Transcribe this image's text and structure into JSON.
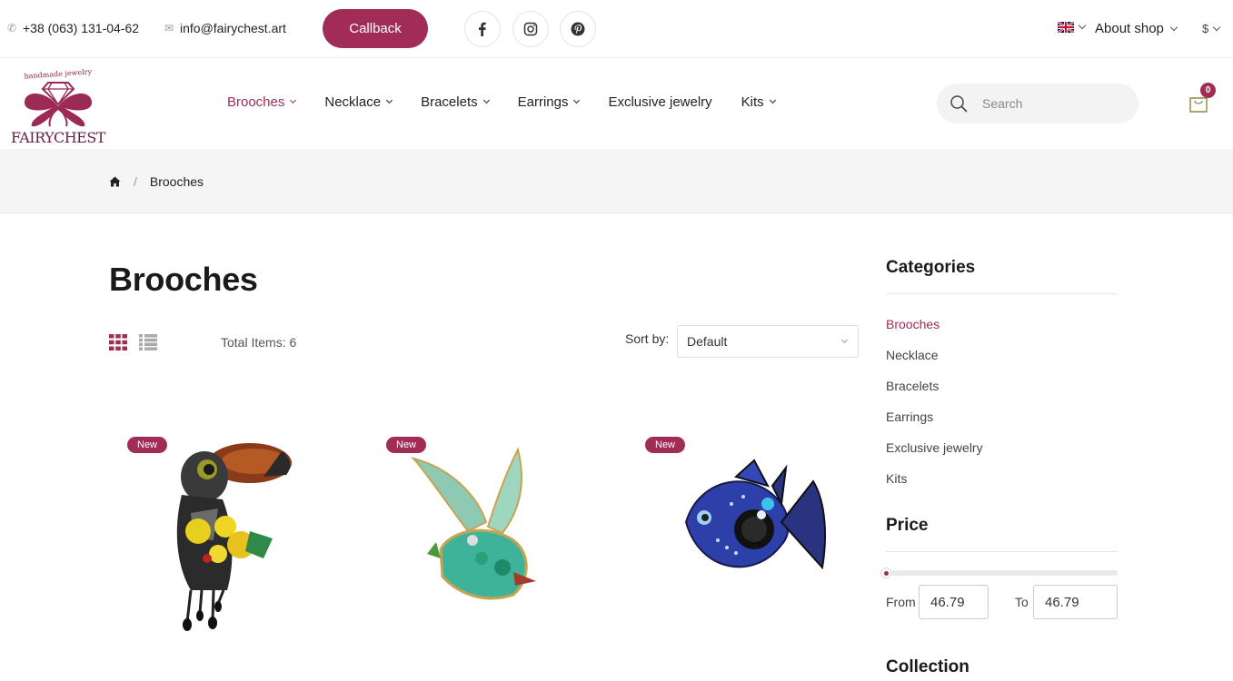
{
  "topbar": {
    "phone": "+38 (063) 131-04-62",
    "email": "info@fairychest.art",
    "callback_label": "Callback",
    "socials": [
      "facebook-icon",
      "instagram-icon",
      "pinterest-icon"
    ],
    "about_label": "About shop",
    "currency": "$"
  },
  "header": {
    "logo_tagline": "handmade jewelry",
    "logo_text": "FAIRYCHEST",
    "nav": [
      {
        "label": "Brooches",
        "active": true
      },
      {
        "label": "Necklace"
      },
      {
        "label": "Bracelets"
      },
      {
        "label": "Earrings"
      },
      {
        "label": "Exclusive jewelry"
      },
      {
        "label": "Kits"
      }
    ],
    "search_placeholder": "Search",
    "cart_count": "0"
  },
  "breadcrumb": {
    "current": "Brooches"
  },
  "main": {
    "title": "Brooches",
    "total_items": "Total Items: 6",
    "sort_label": "Sort by:",
    "sort_value": "Default",
    "products": [
      {
        "badge": "New",
        "image": "toucan brooch"
      },
      {
        "badge": "New",
        "image": "bird brooch"
      },
      {
        "badge": "New",
        "image": "fish brooch"
      }
    ]
  },
  "sidebar": {
    "categories_heading": "Categories",
    "categories": [
      "Brooches",
      "Necklace",
      "Bracelets",
      "Earrings",
      "Exclusive jewelry",
      "Kits"
    ],
    "price_heading": "Price",
    "from_label": "From",
    "from_value": "46.79",
    "to_label": "To",
    "to_value": "46.79",
    "collection_heading": "Collection"
  },
  "colors": {
    "accent": "#a12c56"
  }
}
